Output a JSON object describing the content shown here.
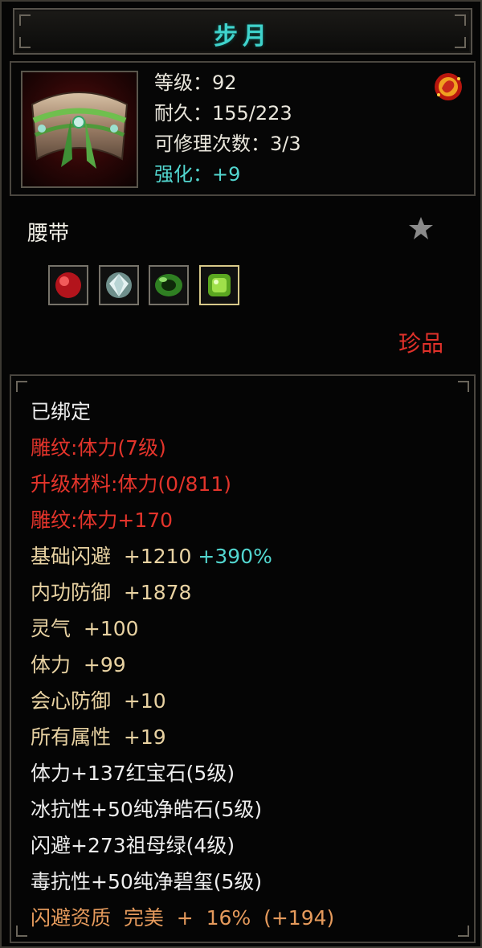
{
  "title": "步月",
  "item": {
    "icon": "belt-icon",
    "level": "等级：92",
    "durability": "耐久：155/223",
    "repairs": "可修理次数：3/3",
    "enhance": "强化：+9",
    "emblem_icon": "fire-emblem-icon"
  },
  "type": "腰带",
  "star_icon": "star-icon",
  "gems": [
    {
      "icon": "ruby-gem-icon",
      "color": "#c81d25"
    },
    {
      "icon": "diamond-gem-icon",
      "color": "#c9d6d8"
    },
    {
      "icon": "emerald-ring-gem-icon",
      "color": "#3f9a2c"
    },
    {
      "icon": "jade-gem-icon",
      "color": "#8bd12f"
    }
  ],
  "rarity": "珍品",
  "attributes": {
    "bound": "已绑定",
    "engrave": "雕纹:体力(7级)",
    "upgrade_material": "升级材料:体力(0/811)",
    "engrave_bonus": "雕纹:体力+170",
    "base_dodge_label": "基础闪避  +1210",
    "base_dodge_bonus": "+390%",
    "inner_defense": "内功防御  +1878",
    "spirit": "灵气  +100",
    "stamina": "体力  +99",
    "crit_defense": "会心防御  +10",
    "all_attributes": "所有属性  +19",
    "gem_line_1": "体力+137红宝石(5级)",
    "gem_line_2": "冰抗性+50纯净皓石(5级)",
    "gem_line_3": "闪避+273祖母绿(4级)",
    "gem_line_4": "毒抗性+50纯净碧玺(5级)",
    "dodge_quality": "闪避资质  完美  +  16%  (+194)"
  },
  "colors": {
    "title": "#3fd3cc",
    "red": "#e3342b",
    "gold": "#e8d2a2",
    "cyan": "#52d6cf",
    "orange": "#e59a5c"
  }
}
